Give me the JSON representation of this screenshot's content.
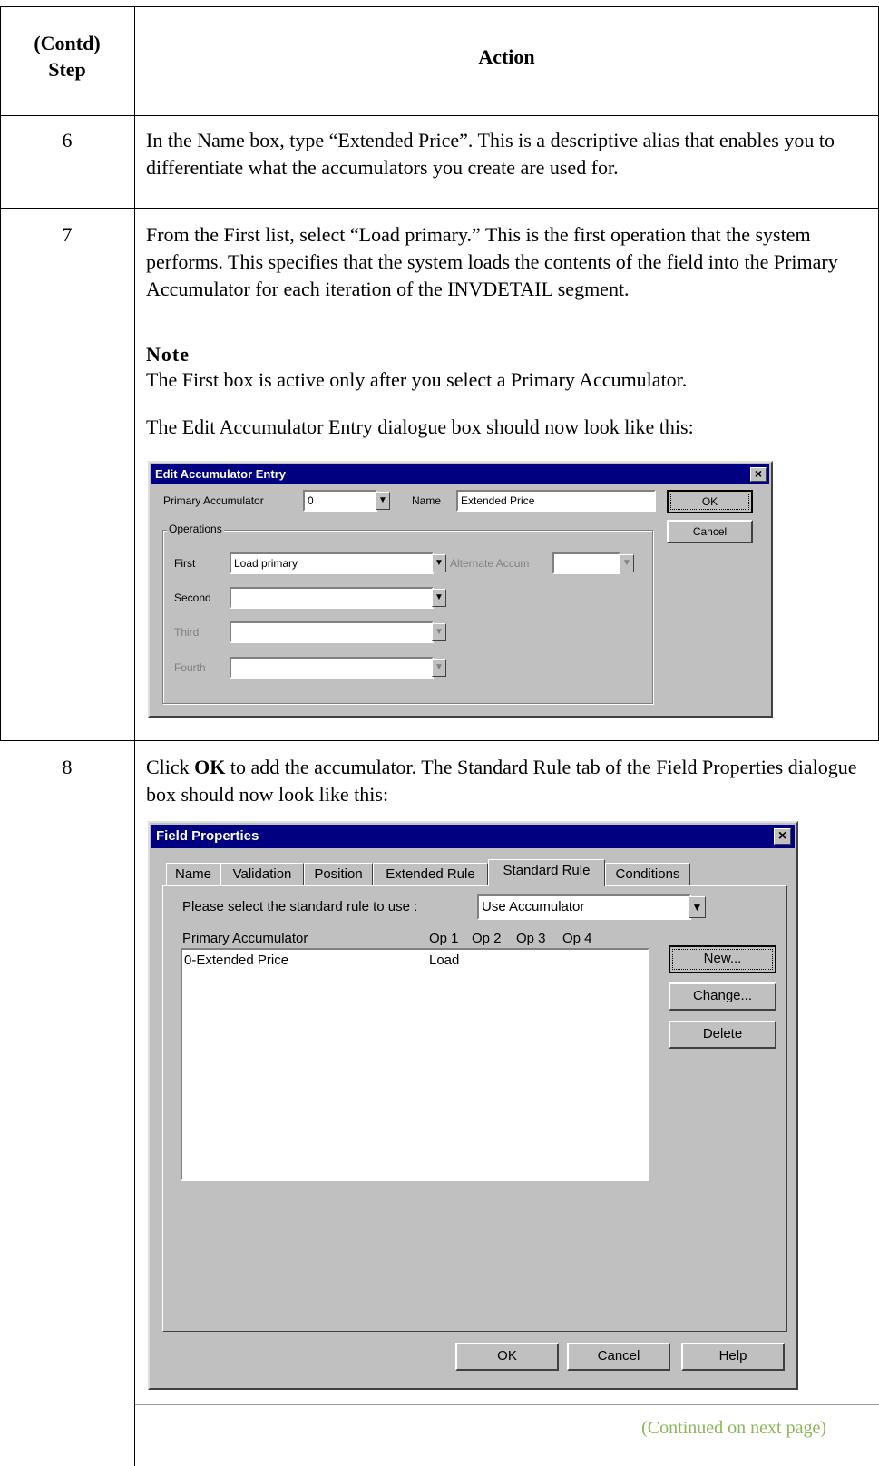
{
  "table": {
    "header_step": "(Contd) Step",
    "header_step_line1": "(Contd)",
    "header_step_line2": "Step",
    "header_action": "Action"
  },
  "rows": {
    "r6": {
      "step": "6",
      "text": "In the Name box, type “Extended Price”. This is a descriptive alias that enables you to differentiate what the accumulators you create are used for."
    },
    "r7": {
      "step": "7",
      "text": "From the First list, select “Load primary.” This is the first operation that the system performs. This specifies that the system loads the contents of the field into the Primary Accumulator for each iteration of the INVDETAIL segment.",
      "note_title": "Note",
      "note_text": "The First box is active only after you select a Primary Accumulator.",
      "after_text": "The Edit Accumulator Entry dialogue box should now look like this:"
    },
    "r8": {
      "step": "8",
      "text_prefix": "Click ",
      "text_bold": "OK",
      "text_suffix": " to add the accumulator. The Standard Rule tab of the Field Properties dialogue box should now look like this:"
    }
  },
  "edit_dialog": {
    "title": "Edit Accumulator Entry",
    "close": "×",
    "primary_label": "Primary Accumulator",
    "primary_value": "0",
    "name_label": "Name",
    "name_value": "Extended Price",
    "ok": "OK",
    "cancel": "Cancel",
    "operations_label": "Operations",
    "first_label": "First",
    "first_value": "Load primary",
    "alternate_label": "Alternate Accum",
    "second_label": "Second",
    "third_label": "Third",
    "fourth_label": "Fourth"
  },
  "field_dialog": {
    "title": "Field Properties",
    "close": "×",
    "tabs": [
      "Name",
      "Validation",
      "Position",
      "Extended Rule",
      "Standard Rule",
      "Conditions"
    ],
    "active_tab": "Standard Rule",
    "select_label": "Please select the standard rule to use :",
    "select_value": "Use Accumulator",
    "col_primary": "Primary Accumulator",
    "col_op1": "Op 1",
    "col_op2": "Op 2",
    "col_op3": "Op 3",
    "col_op4": "Op 4",
    "row_name": "0-Extended Price",
    "row_op1": "Load",
    "new_btn": "New...",
    "change_btn": "Change...",
    "delete_btn": "Delete",
    "ok_btn": "OK",
    "cancel_btn": "Cancel",
    "help_btn": "Help"
  },
  "footer": {
    "continued": "(Continued on next page)",
    "continued_color": "#8db65a"
  }
}
